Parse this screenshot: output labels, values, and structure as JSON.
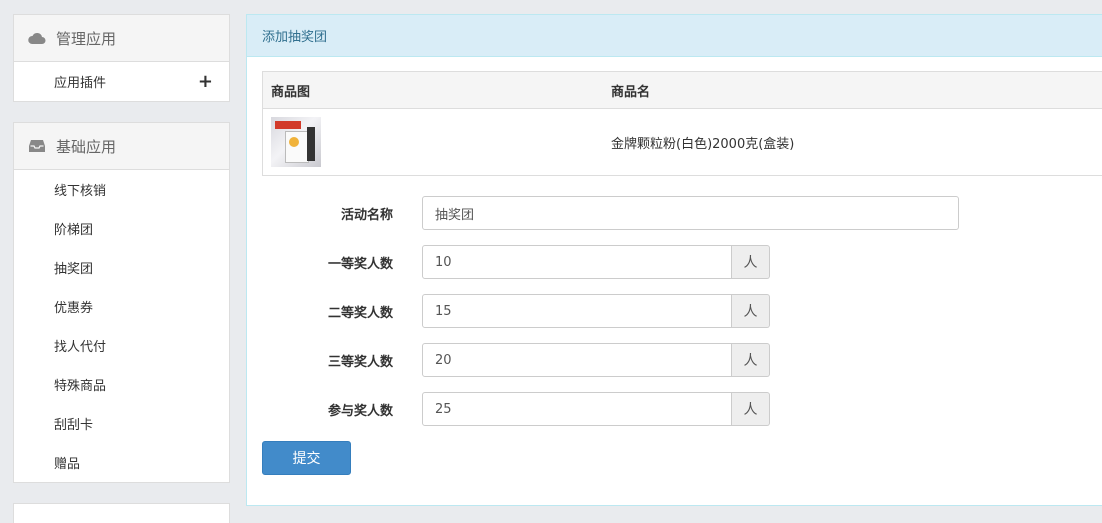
{
  "sidebar": {
    "manage": {
      "title": "管理应用",
      "icon": "cloud-icon",
      "items": [
        {
          "label": "应用插件",
          "action_icon": "plus-icon",
          "action_glyph": "+"
        }
      ]
    },
    "basic": {
      "title": "基础应用",
      "icon": "inbox-icon",
      "items": [
        {
          "label": "线下核销"
        },
        {
          "label": "阶梯团"
        },
        {
          "label": "抽奖团"
        },
        {
          "label": "优惠券"
        },
        {
          "label": "找人代付"
        },
        {
          "label": "特殊商品"
        },
        {
          "label": "刮刮卡"
        },
        {
          "label": "赠品"
        }
      ]
    }
  },
  "main": {
    "header": "添加抽奖团",
    "table": {
      "headers": [
        "商品图",
        "商品名"
      ],
      "rows": [
        {
          "name": "金牌颗粒粉(白色)2000克(盒装)"
        }
      ]
    },
    "form": {
      "activity_name_label": "活动名称",
      "activity_name_value": "抽奖团",
      "fields": [
        {
          "label": "一等奖人数",
          "value": "10",
          "unit": "人"
        },
        {
          "label": "二等奖人数",
          "value": "15",
          "unit": "人"
        },
        {
          "label": "三等奖人数",
          "value": "20",
          "unit": "人"
        },
        {
          "label": "参与奖人数",
          "value": "25",
          "unit": "人"
        }
      ],
      "submit_label": "提交"
    }
  },
  "colors": {
    "primary": "#428bca",
    "header_bg": "#d9edf7",
    "header_text": "#31708f"
  }
}
